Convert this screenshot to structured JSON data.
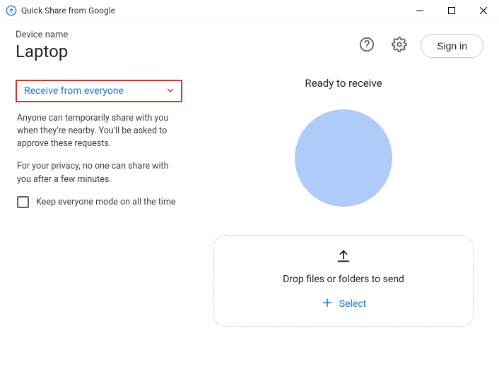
{
  "titlebar": {
    "app_title": "Quick Share from Google"
  },
  "header": {
    "device_label": "Device name",
    "device_name": "Laptop",
    "signin_label": "Sign in"
  },
  "left": {
    "dropdown_label": "Receive from everyone",
    "desc1": "Anyone can temporarily share with you when they're nearby. You'll be asked to approve these requests.",
    "desc2": "For your privacy, no one can share with you after a few minutes.",
    "checkbox_label": "Keep everyone mode on all the time"
  },
  "right": {
    "ready_title": "Ready to receive",
    "drop_text": "Drop files or folders to send",
    "select_label": "Select"
  }
}
